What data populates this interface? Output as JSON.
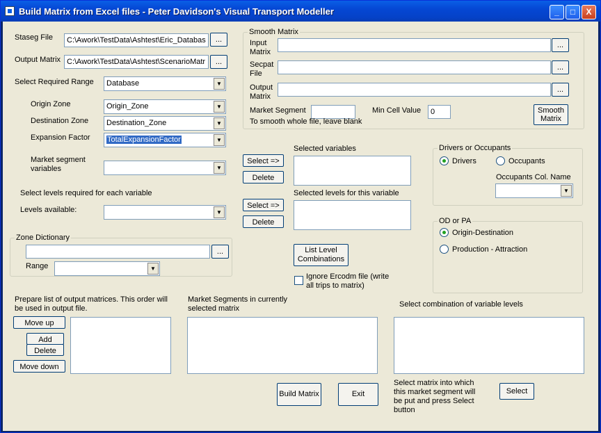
{
  "window": {
    "title": "Build Matrix from Excel files - Peter Davidson's Visual Transport Modeller"
  },
  "titlebar_buttons": {
    "minimize": "_",
    "maximize": "□",
    "close": "X"
  },
  "browse_label": "...",
  "left": {
    "staseg_label": "Staseg File",
    "staseg_value": "C:\\Awork\\TestData\\Ashtest\\Eric_Databas",
    "output_matrix_label": "Output Matrix",
    "output_matrix_value": "C:\\Awork\\TestData\\Ashtest\\ScenarioMatr",
    "range_label": "Select Required Range",
    "range_value": "Database",
    "origin_label": "Origin Zone",
    "origin_value": "Origin_Zone",
    "dest_label": "Destination Zone",
    "dest_value": "Destination_Zone",
    "exp_label": "Expansion Factor",
    "exp_value": "TotalExpansionFactor",
    "market_label_1": "Market segment",
    "market_label_2": "variables",
    "market_value": "",
    "levels_note": "Select levels required for each variable",
    "levels_label": "Levels available:",
    "levels_value": ""
  },
  "zone_dict": {
    "title": "Zone Dictionary",
    "value": "",
    "range_label": "Range",
    "range_value": ""
  },
  "smooth": {
    "title": "Smooth Matrix",
    "input_label_1": "Input",
    "input_label_2": "Matrix",
    "secpat_label_1": "Secpat",
    "secpat_label_2": "File",
    "output_label_1": "Output",
    "output_label_2": "Matrix",
    "market_label": "Market Segment",
    "whole_note": "To smooth whole file, leave blank",
    "mincell_label": "Min Cell Value",
    "mincell_value": "0",
    "button_1": "Smooth",
    "button_2": "Matrix"
  },
  "middle": {
    "select_btn": "Select =>",
    "delete_btn": "Delete",
    "selected_vars_label": "Selected variables",
    "selected_levels_label": "Selected levels for this variable",
    "list_level_1": "List Level",
    "list_level_2": "Combinations",
    "ignore_1": "Ignore Ercodm file (write",
    "ignore_2": "all trips to matrix)"
  },
  "drivers": {
    "title": "Drivers or Occupants",
    "drivers_label": "Drivers",
    "occupants_label": "Occupants",
    "col_label": "Occupants Col. Name",
    "col_value": ""
  },
  "odpa": {
    "title": "OD or PA",
    "od_label": "Origin-Destination",
    "pa_label": "Production - Attraction"
  },
  "bottom": {
    "prepare_1": "Prepare list of output matrices. This order will",
    "prepare_2": "be used in output file.",
    "move_up": "Move up",
    "add": "Add",
    "delete": "Delete",
    "move_down": "Move down",
    "segments_1": "Market Segments in currently",
    "segments_2": "selected matrix",
    "combination_label": "Select combination of variable levels",
    "build": "Build Matrix",
    "exit": "Exit",
    "note_1": "Select matrix into which",
    "note_2": "this market segment will",
    "note_3": "be put and press Select",
    "note_4": "button",
    "select": "Select"
  }
}
